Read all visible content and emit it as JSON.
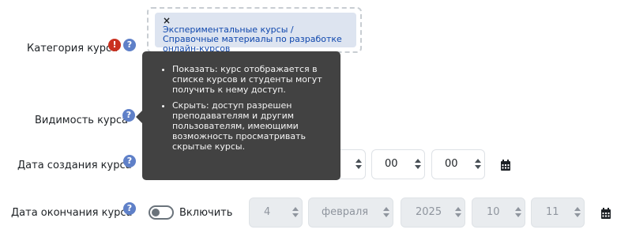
{
  "course_category": {
    "label": "Категория курса",
    "selected_chip": "Экспериментальные курсы / Справочные материалы по разработке онлайн-курсов",
    "remove_glyph": "×"
  },
  "course_visibility": {
    "label": "Видимость курса",
    "tooltip_items": [
      "Показать: курс отображается в списке курсов и студенты могут получить к нему доступ.",
      "Скрыть: доступ разрешен преподавателям и другим пользователям, имеющими возможность просматривать скрытые курсы."
    ]
  },
  "start_date": {
    "label": "Дата создания курса",
    "hour": "00",
    "minute": "00"
  },
  "end_date": {
    "label": "Дата окончания курса",
    "enable_label": "Включить",
    "enabled": false,
    "day": "4",
    "month": "февраля",
    "year": "2025",
    "hour": "10",
    "minute": "11"
  },
  "icons": {
    "help": "question-circle-icon",
    "required": "exclamation-circle-icon",
    "calendar": "calendar-icon"
  },
  "colors": {
    "help_icon": "#5f80c8",
    "required_icon": "#ca3120",
    "tooltip_bg": "#424242",
    "chip_bg": "#dde4f0",
    "chip_text": "#0f47ad"
  }
}
